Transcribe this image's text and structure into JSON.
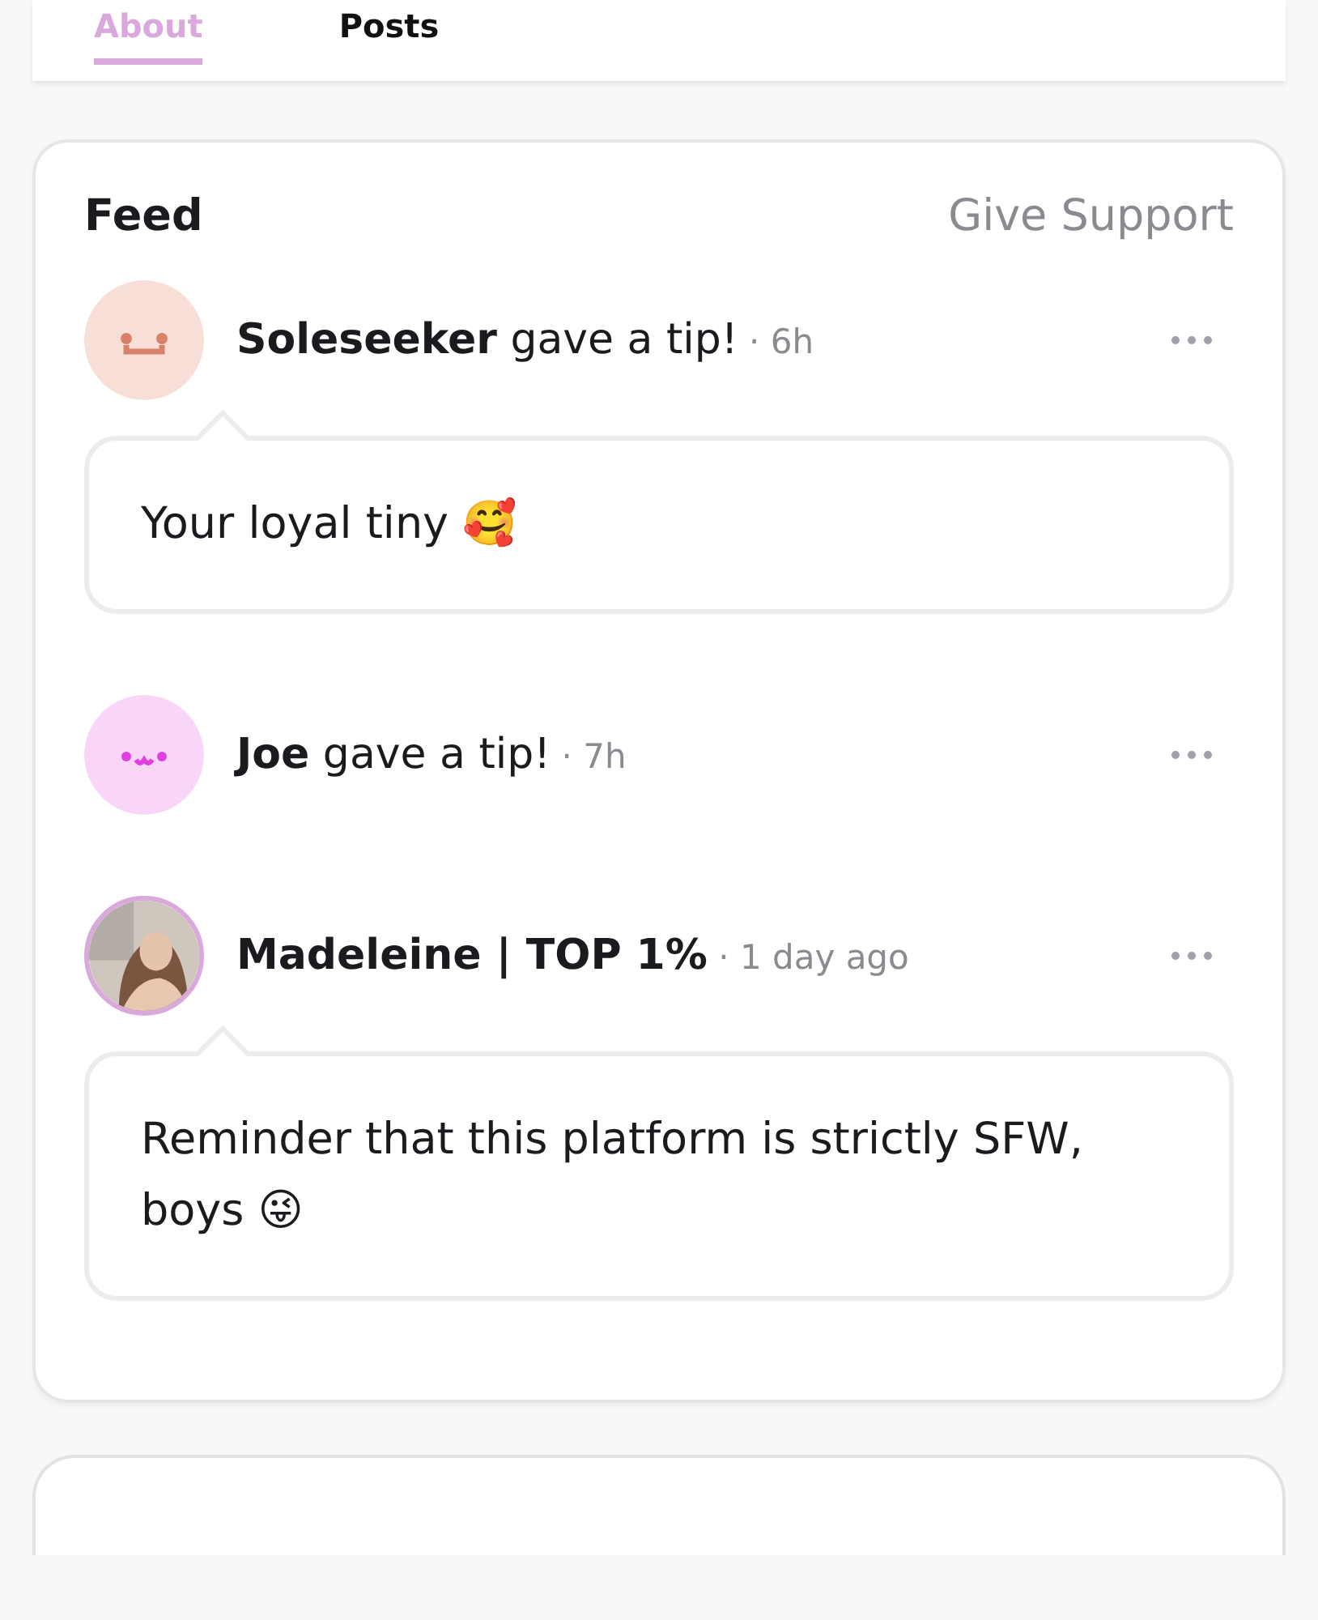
{
  "tabs": [
    {
      "label": "About",
      "selected": true
    },
    {
      "label": "Posts",
      "selected": false
    }
  ],
  "feed": {
    "title": "Feed",
    "action": "Give Support",
    "items": [
      {
        "kind": "tip",
        "color": "#f7ded6",
        "name": "Soleseeker",
        "action": "gave a tip!",
        "time": "· 6h",
        "message": "Your loyal tiny 🥰"
      },
      {
        "kind": "tip",
        "color": "#f9d6f7",
        "name": "Joe",
        "action": "gave a tip!",
        "time": "· 7h"
      },
      {
        "kind": "post",
        "name": "Madeleine | TOP 1%",
        "time": "· 1 day ago",
        "message": "Reminder that this platform is strictly SFW, boys 😜"
      }
    ]
  }
}
